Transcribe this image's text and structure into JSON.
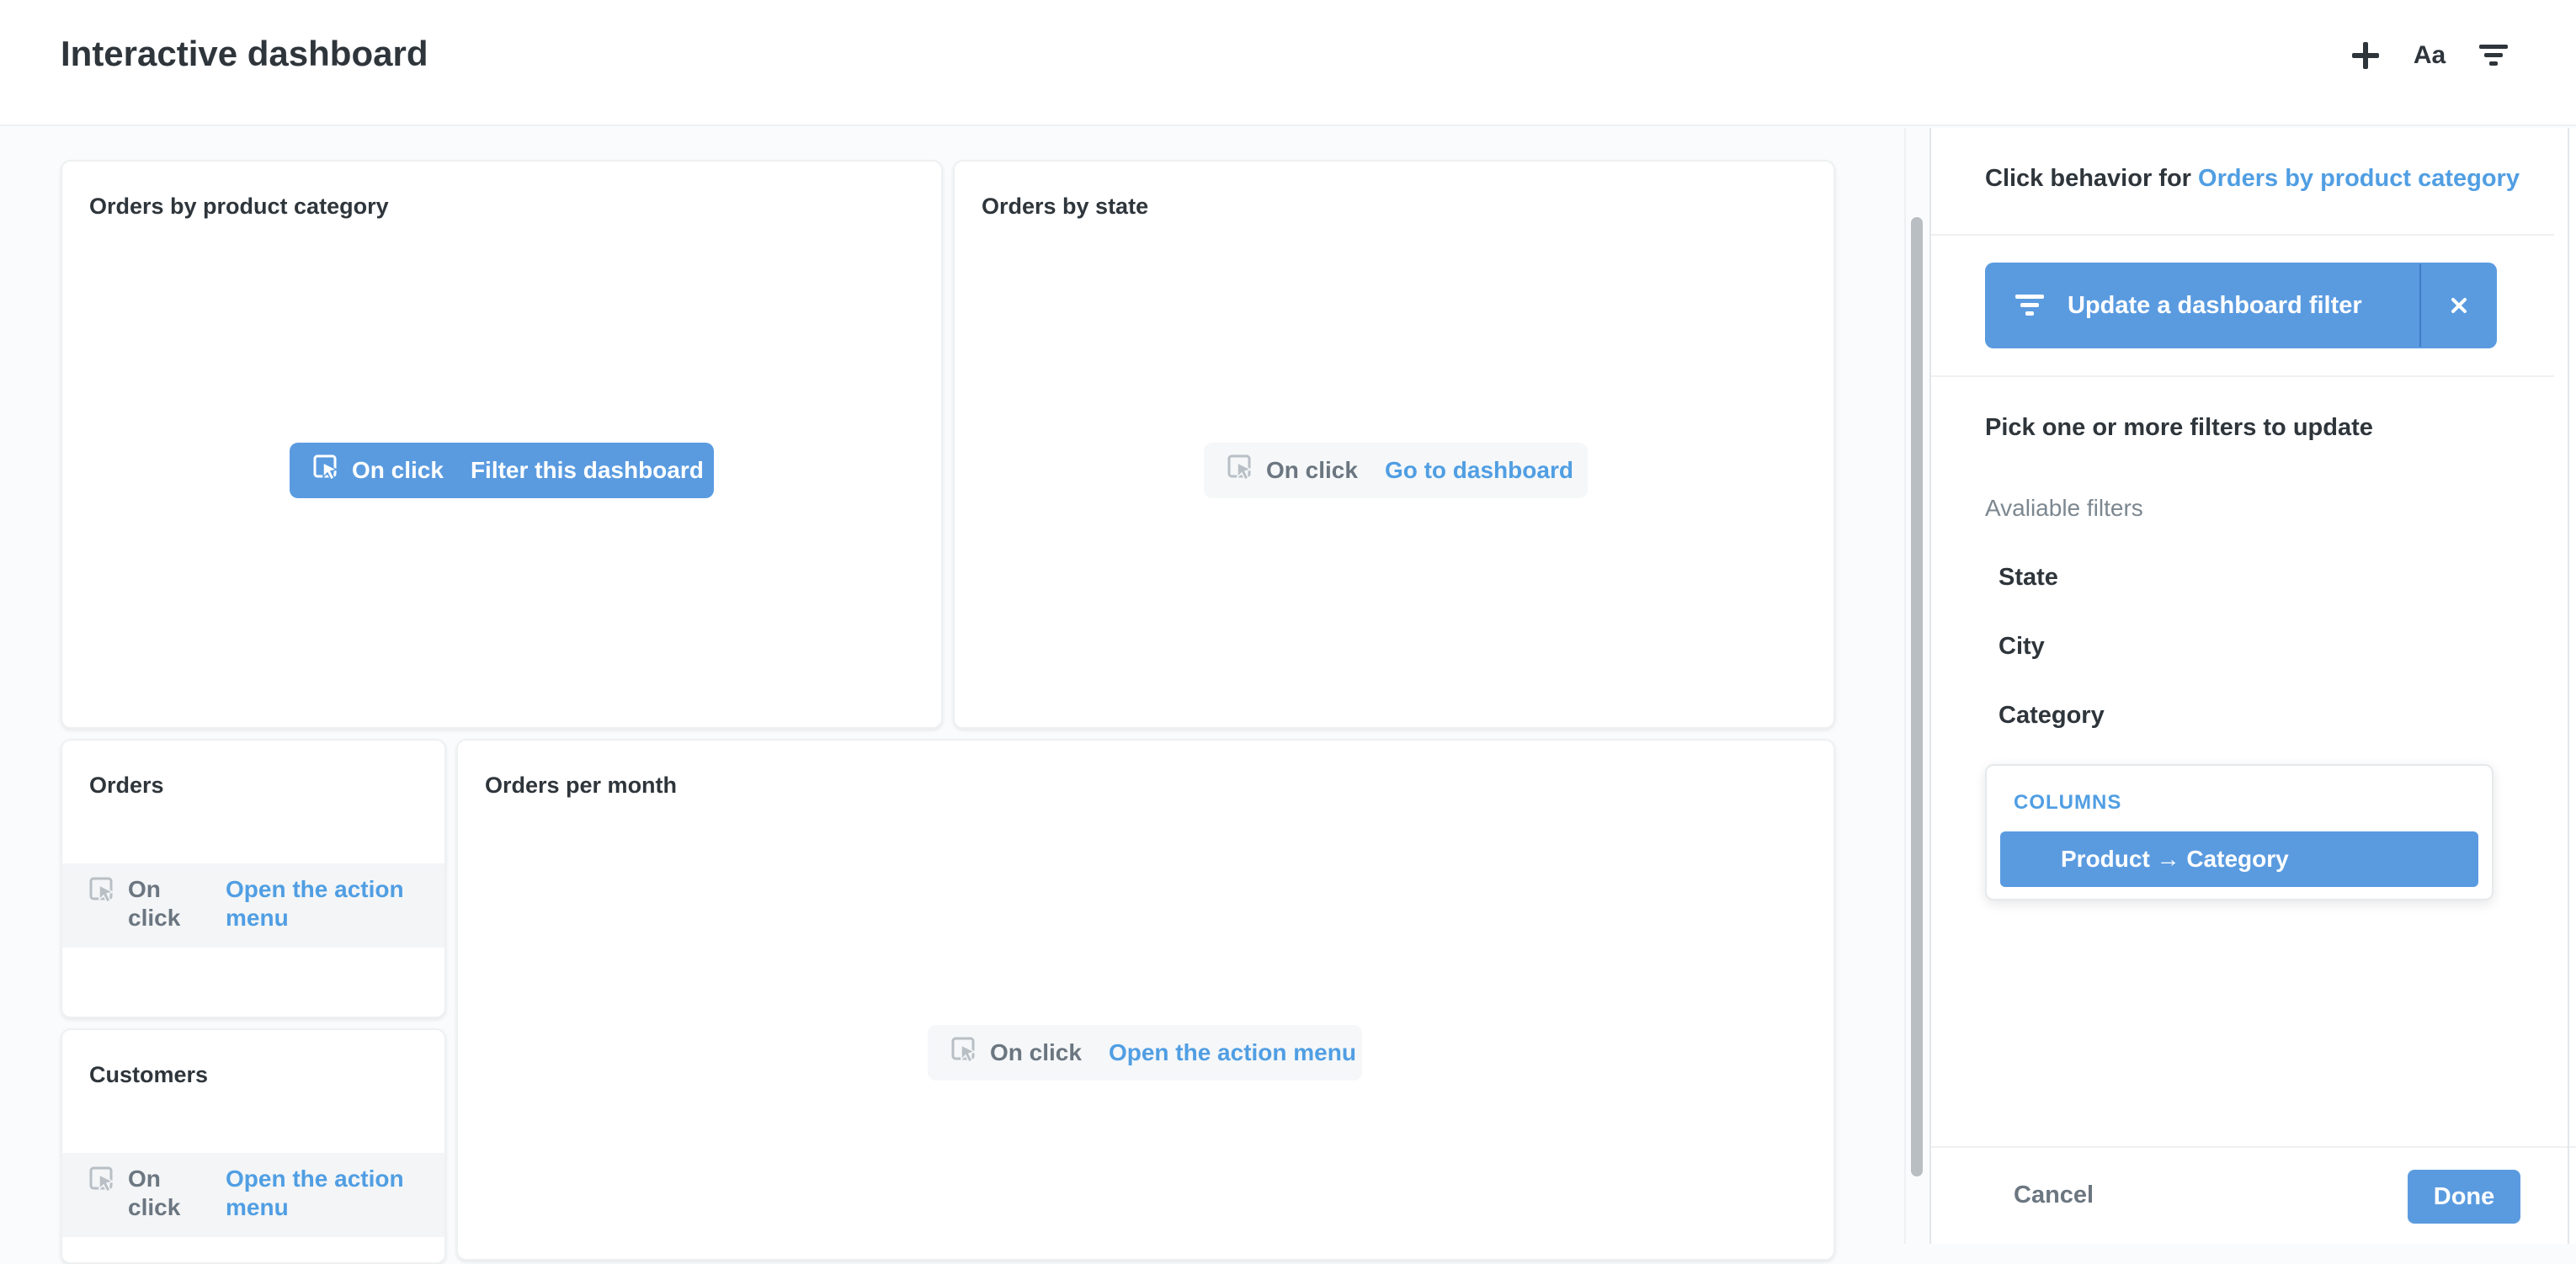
{
  "header": {
    "title": "Interactive dashboard",
    "icons": [
      "add-icon",
      "text-format-icon",
      "filter-icon"
    ],
    "text_icon_label": "Aa"
  },
  "cards": {
    "product_category": {
      "title": "Orders by product category",
      "on_click": "On click",
      "action": "Filter this dashboard"
    },
    "state": {
      "title": "Orders by state",
      "on_click": "On click",
      "action": "Go to dashboard"
    },
    "orders": {
      "title": "Orders",
      "on_click": "On click",
      "action": "Open the action menu"
    },
    "customers": {
      "title": "Customers",
      "on_click": "On click",
      "action": "Open the action menu"
    },
    "per_month": {
      "title": "Orders per month",
      "on_click": "On click",
      "action": "Open the action menu"
    }
  },
  "sidebar": {
    "heading_prefix": "Click behavior for",
    "heading_link": "Orders by product category",
    "behavior_label": "Update a dashboard filter",
    "pick_label": "Pick one or more filters to update",
    "available_label": "Avaliable filters",
    "filters": [
      "State",
      "City",
      "Category"
    ],
    "columns_heading": "COLUMNS",
    "column_item": "Product → Category",
    "cancel_label": "Cancel",
    "done_label": "Done"
  },
  "colors": {
    "brand": "#509ee3",
    "brand_fill": "#5a9be0",
    "text": "#2e353b",
    "muted": "#6b7680"
  }
}
